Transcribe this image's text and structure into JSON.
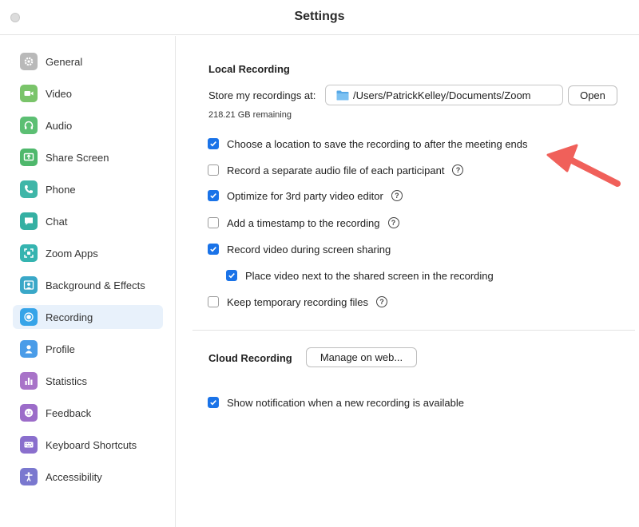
{
  "window": {
    "title": "Settings"
  },
  "sidebar": {
    "items": [
      {
        "label": "General",
        "icon": "gear-icon",
        "color": "#b9b9b9"
      },
      {
        "label": "Video",
        "icon": "video-camera-icon",
        "color": "#7ac46a"
      },
      {
        "label": "Audio",
        "icon": "headphones-icon",
        "color": "#5cbf73"
      },
      {
        "label": "Share Screen",
        "icon": "share-screen-icon",
        "color": "#4fb86c"
      },
      {
        "label": "Phone",
        "icon": "phone-icon",
        "color": "#3fb6a8"
      },
      {
        "label": "Chat",
        "icon": "chat-bubble-icon",
        "color": "#35b0a3"
      },
      {
        "label": "Zoom Apps",
        "icon": "apps-icon",
        "color": "#35b4b0"
      },
      {
        "label": "Background & Effects",
        "icon": "person-frame-icon",
        "color": "#3aa8c8"
      },
      {
        "label": "Recording",
        "icon": "record-icon",
        "color": "#36a4e8"
      },
      {
        "label": "Profile",
        "icon": "profile-icon",
        "color": "#4a9ce8"
      },
      {
        "label": "Statistics",
        "icon": "statistics-icon",
        "color": "#a873c8"
      },
      {
        "label": "Feedback",
        "icon": "smiley-icon",
        "color": "#9c6cc9"
      },
      {
        "label": "Keyboard Shortcuts",
        "icon": "keyboard-icon",
        "color": "#8a6fcd"
      },
      {
        "label": "Accessibility",
        "icon": "accessibility-icon",
        "color": "#7a78cf"
      }
    ],
    "active": "Recording"
  },
  "local": {
    "title": "Local Recording",
    "store_label": "Store my recordings at:",
    "path": "/Users/PatrickKelley/Documents/Zoom",
    "open_label": "Open",
    "remaining": "218.21 GB remaining",
    "options": [
      {
        "label": "Choose a location to save the recording to after the meeting ends",
        "checked": true,
        "help": false
      },
      {
        "label": "Record a separate audio file of each participant",
        "checked": false,
        "help": true
      },
      {
        "label": "Optimize for 3rd party video editor",
        "checked": true,
        "help": true
      },
      {
        "label": "Add a timestamp to the recording",
        "checked": false,
        "help": true
      },
      {
        "label": "Record video during screen sharing",
        "checked": true,
        "help": false
      },
      {
        "label": "Place video next to the shared screen in the recording",
        "checked": true,
        "help": false
      },
      {
        "label": "Keep temporary recording files",
        "checked": false,
        "help": true
      }
    ]
  },
  "cloud": {
    "title": "Cloud Recording",
    "manage_label": "Manage on web...",
    "options": [
      {
        "label": "Show notification when a new recording is available",
        "checked": true
      }
    ]
  },
  "help_glyph": "?",
  "colors": {
    "accent": "#1a73e8",
    "annotation_arrow": "#f0605a",
    "active_item_bg": "#e8f1fb"
  }
}
